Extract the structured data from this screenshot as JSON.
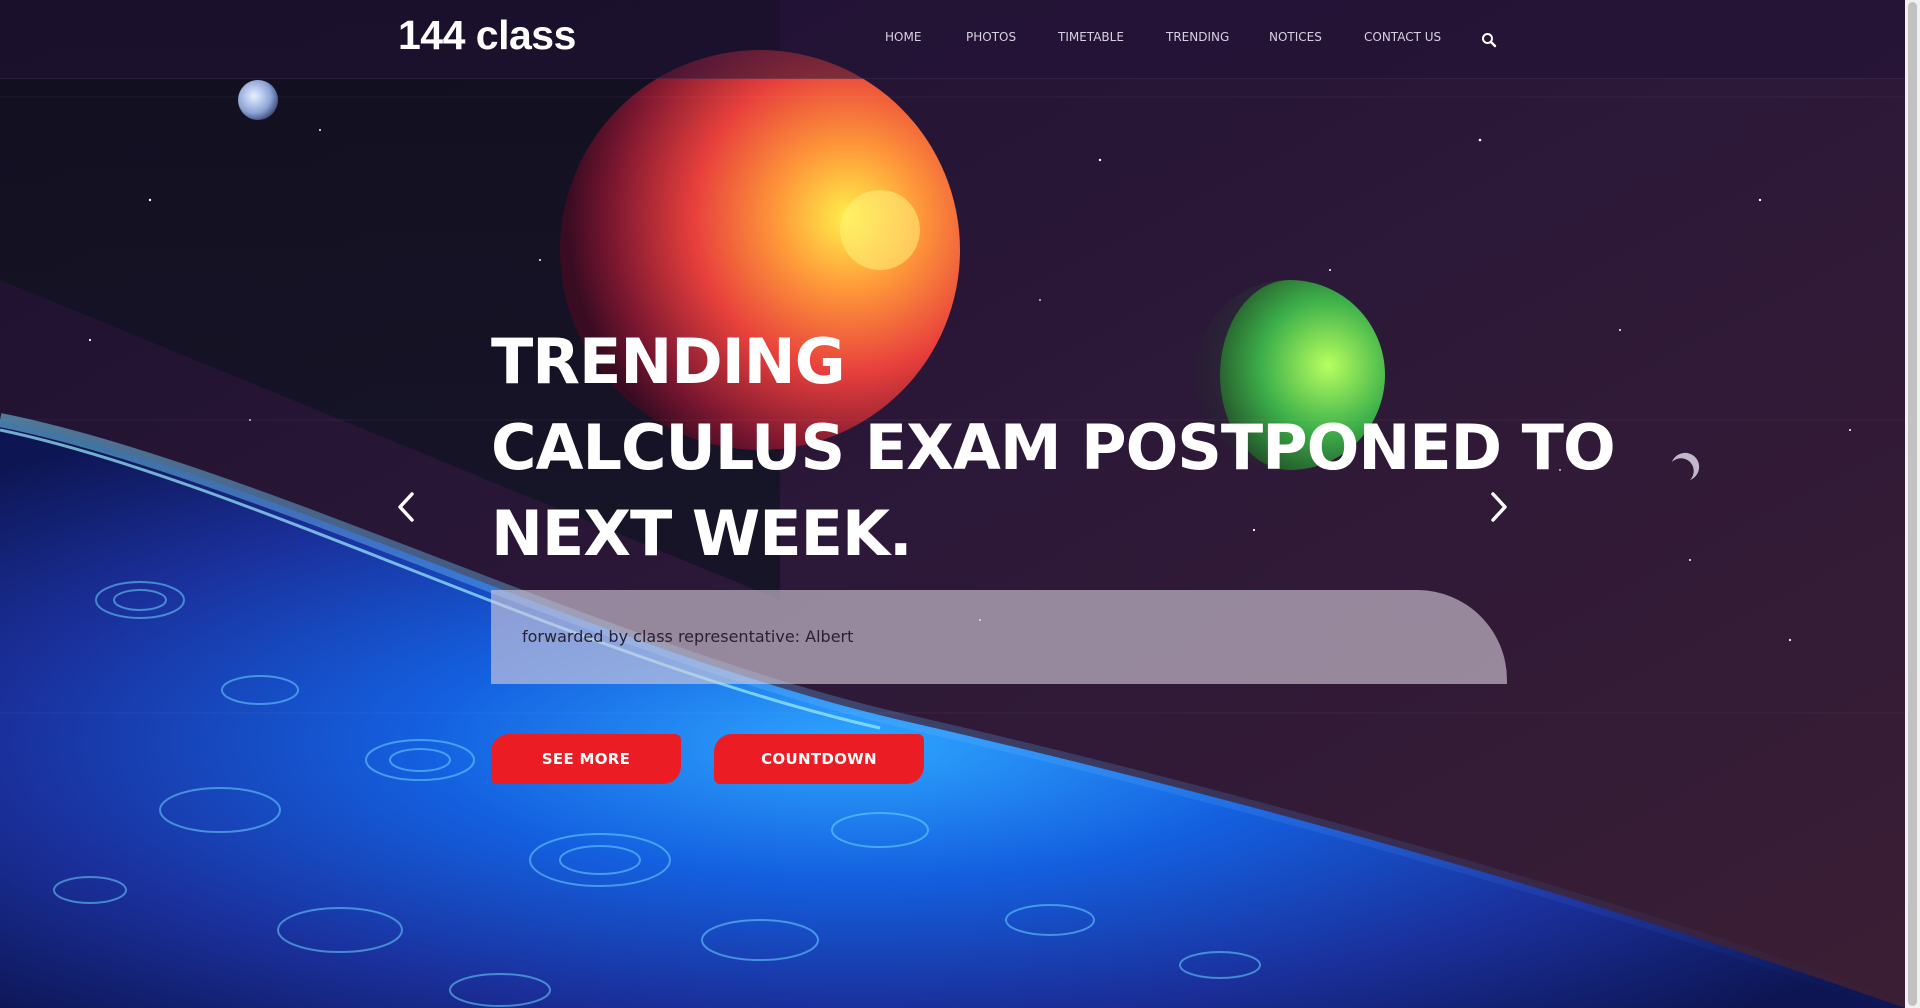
{
  "site": {
    "logo": "144 class"
  },
  "nav": {
    "items": [
      {
        "label": "HOME"
      },
      {
        "label": "PHOTOS"
      },
      {
        "label": "TIMETABLE"
      },
      {
        "label": "TRENDING"
      },
      {
        "label": "NOTICES"
      },
      {
        "label": "CONTACT US"
      }
    ],
    "search_icon": "search-icon"
  },
  "hero": {
    "line1": "TRENDING",
    "line2": "CALCULUS EXAM POSTPONED TO",
    "line3": "NEXT WEEK.",
    "caption": "forwarded by class representative: Albert",
    "see_more_label": "SEE MORE",
    "countdown_label": "COUNTDOWN",
    "prev_icon": "chevron-left-icon",
    "next_icon": "chevron-right-icon"
  },
  "colors": {
    "button": "#ec1c24",
    "nav_text": "#d7d0e2",
    "headline": "#ffffff",
    "sky": "#2a1838"
  }
}
